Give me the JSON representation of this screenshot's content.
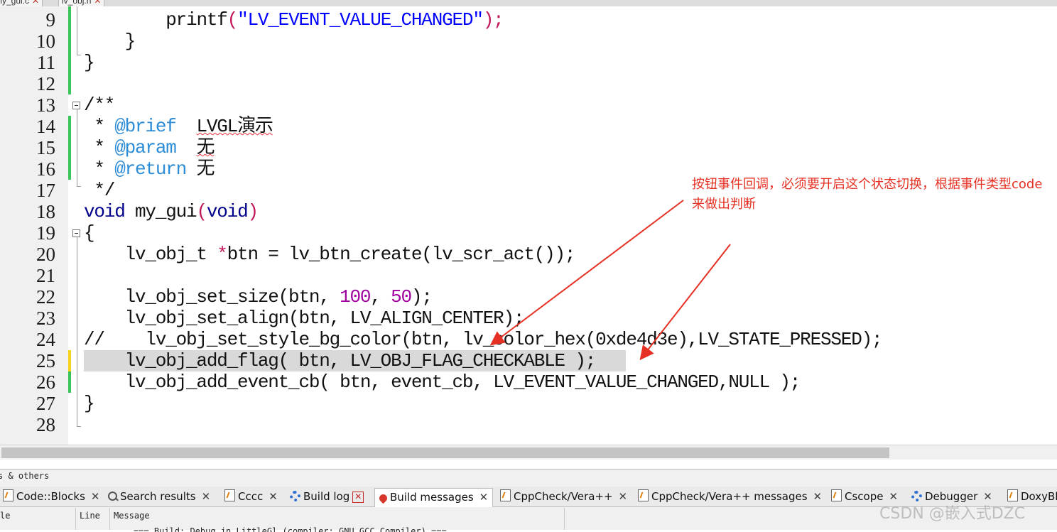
{
  "file_tabs": [
    {
      "label": "my_gui.c"
    },
    {
      "label": "lv_obj.h"
    }
  ],
  "editor": {
    "line_numbers": [
      "9",
      "10",
      "11",
      "12",
      "13",
      "14",
      "15",
      "16",
      "17",
      "18",
      "19",
      "20",
      "21",
      "22",
      "23",
      "24",
      "25",
      "26",
      "27",
      "28"
    ],
    "lines": {
      "l9": {
        "indent": "        ",
        "fn": "printf",
        "p1": "(",
        "str": "\"LV_EVENT_VALUE_CHANGED\"",
        "p2": ");"
      },
      "l10": {
        "text": "    }"
      },
      "l11": {
        "text": "}"
      },
      "l13": {
        "text": "/**"
      },
      "l14": {
        "star": " * ",
        "tag": "@brief",
        "sp": "  ",
        "desc": "LVGL演示"
      },
      "l15": {
        "star": " * ",
        "tag": "@param",
        "sp": "  ",
        "desc": "无"
      },
      "l16": {
        "star": " * ",
        "tag": "@return",
        "sp": " ",
        "desc": "无"
      },
      "l17": {
        "text": " */"
      },
      "l18": {
        "kw1": "void",
        "mid": " my_gui",
        "p1": "(",
        "kw2": "void",
        "p2": ")"
      },
      "l19": {
        "text": "{"
      },
      "l20": {
        "a": "    lv_obj_t ",
        "star": "*",
        "b": "btn = lv_btn_create",
        "c": "(lv_scr_act());"
      },
      "l22": {
        "a": "    lv_obj_set_size(btn, ",
        "n1": "100",
        "b": ", ",
        "n2": "50",
        "c": ");"
      },
      "l23": {
        "text": "    lv_obj_set_align(btn, LV_ALIGN_CENTER);"
      },
      "l24": {
        "text": "//    lv_obj_set_style_bg_color(btn, lv_color_hex(0xde4d3e),LV_STATE_PRESSED);"
      },
      "l25": {
        "text": "    lv_obj_add_flag( btn, LV_OBJ_FLAG_CHECKABLE );"
      },
      "l26": {
        "text": "    lv_obj_add_event_cb( btn, event_cb, LV_EVENT_VALUE_CHANGED,NULL );"
      },
      "l27": {
        "text": "}"
      }
    }
  },
  "annotation": {
    "text": "按钮事件回调，必须要开启这个状态切换，根据事件类型code来做出判断",
    "color": "#e53023"
  },
  "log_panel": {
    "title": "s & others",
    "tabs": [
      {
        "label": "Code::Blocks",
        "icon": "page-icon"
      },
      {
        "label": "Search results",
        "icon": "search-icon"
      },
      {
        "label": "Cccc",
        "icon": "page-icon"
      },
      {
        "label": "Build log",
        "icon": "gear-icon"
      },
      {
        "label": "Build messages",
        "icon": "pin-icon"
      },
      {
        "label": "CppCheck/Vera++",
        "icon": "page-icon"
      },
      {
        "label": "CppCheck/Vera++ messages",
        "icon": "page-icon"
      },
      {
        "label": "Cscope",
        "icon": "page-icon"
      },
      {
        "label": "Debugger",
        "icon": "gear-icon"
      },
      {
        "label": "DoxyBl",
        "icon": "page-icon"
      }
    ],
    "columns": [
      "le",
      "Line",
      "Message"
    ],
    "row_message": "=== Build: Debug in LittleGl (compiler: GNU GCC Compiler) ==="
  },
  "watermark": "CSDN @嵌入式DZC"
}
